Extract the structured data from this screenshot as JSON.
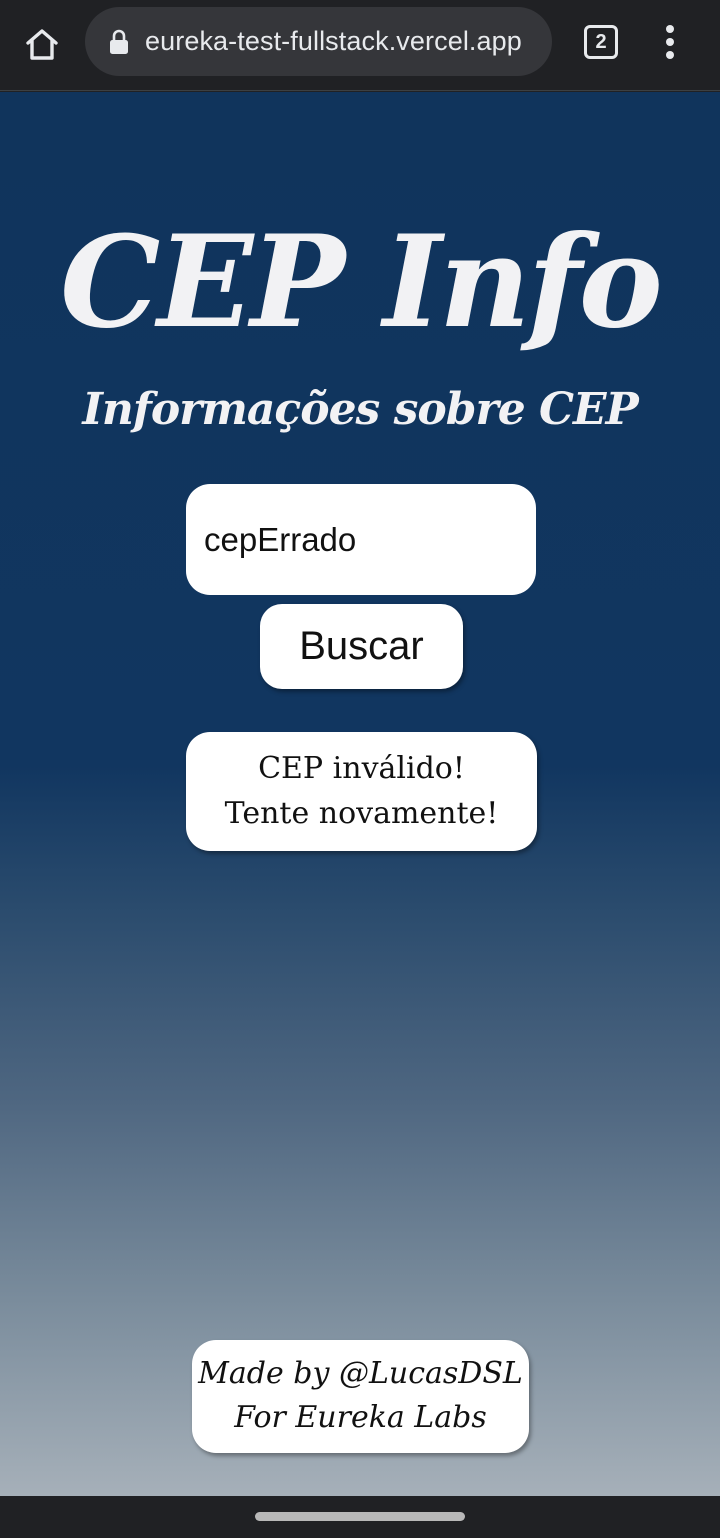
{
  "browser": {
    "url": "eureka-test-fullstack.vercel.app",
    "tab_count": "2"
  },
  "page": {
    "title": "CEP Info",
    "subtitle": "Informações sobre CEP",
    "search": {
      "input_value": "cepErrado",
      "button_label": "Buscar"
    },
    "error": {
      "line1": "CEP inválido!",
      "line2": "Tente novamente!"
    },
    "footer": {
      "line1": "Made by @LucasDSL",
      "line2": "For Eureka Labs"
    }
  },
  "colors": {
    "background_top": "#10345c",
    "background_bottom": "#a6b0b9",
    "title_text": "#f2f2f4",
    "card_background": "#ffffff"
  },
  "icons": [
    "home-icon",
    "lock-icon",
    "tabs-icon",
    "more-vert-icon"
  ]
}
